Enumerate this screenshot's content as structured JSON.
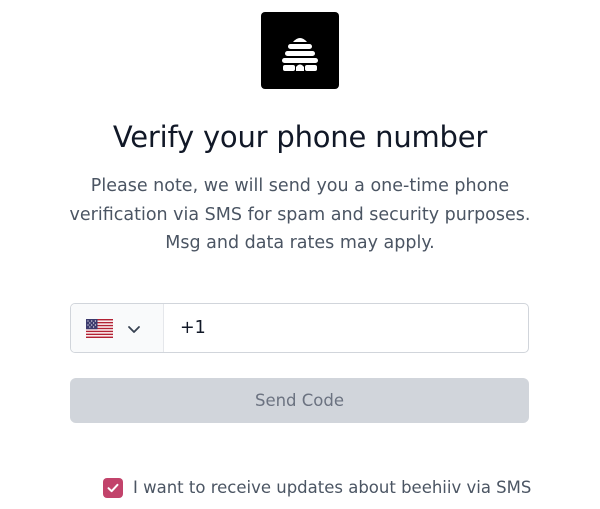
{
  "logo": {
    "icon": "beehive-icon"
  },
  "header": {
    "title": "Verify your phone number"
  },
  "description": {
    "lines": [
      "Please note, we will send you a one-time phone",
      "verification via SMS for spam and security purposes.",
      "Msg and data rates may apply."
    ]
  },
  "phone": {
    "country_flag_icon": "us-flag-icon",
    "dropdown_icon": "chevron-down-icon",
    "value": "+1"
  },
  "actions": {
    "send_code_label": "Send Code",
    "send_code_enabled": false
  },
  "consent": {
    "checked": true,
    "label": "I want to receive updates about beehiiv via SMS",
    "accent_color": "#c2436b"
  },
  "colors": {
    "title": "#111827",
    "body_text": "#4b5563",
    "disabled_button": "#d1d5db",
    "disabled_button_text": "#6b7280"
  }
}
